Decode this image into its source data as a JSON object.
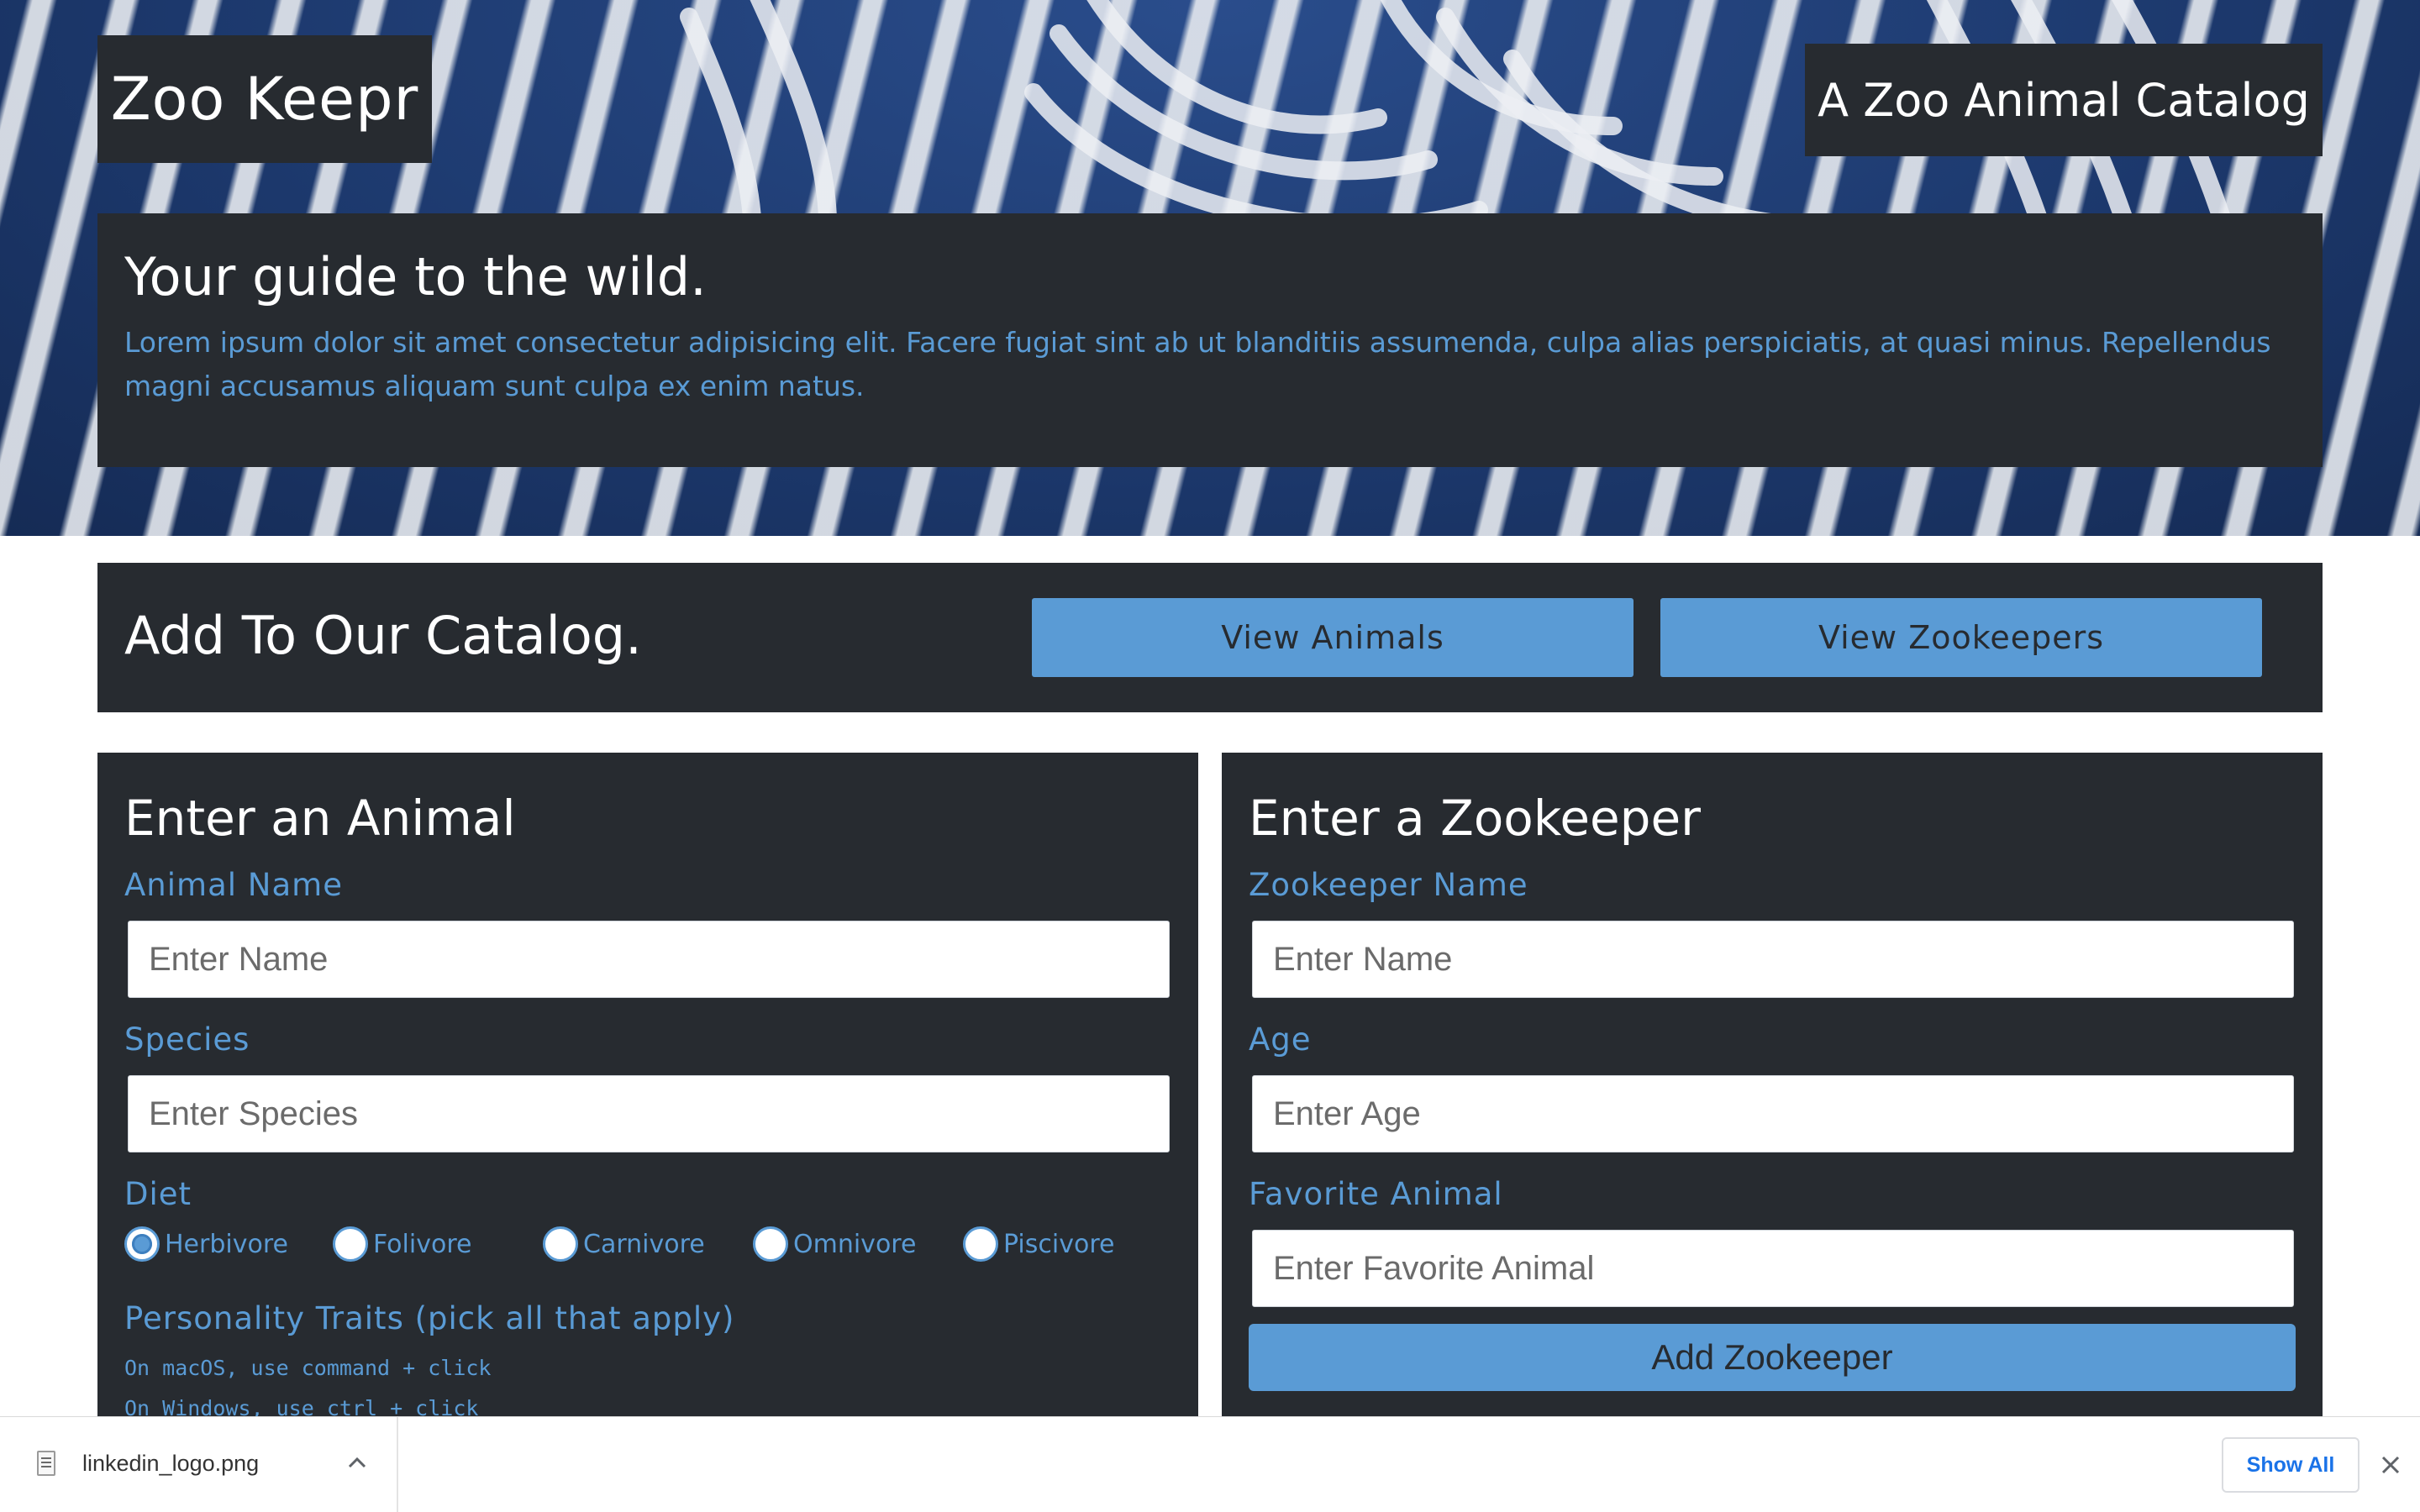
{
  "header": {
    "brand": "Zoo Keepr",
    "tagline": "A Zoo Animal Catalog",
    "intro_title": "Your guide to the wild.",
    "intro_text": "Lorem ipsum dolor sit amet consectetur adipisicing elit. Facere fugiat sint ab ut blanditiis assumenda, culpa alias perspiciatis, at quasi minus. Repellendus magni accusamus aliquam sunt culpa ex enim natus."
  },
  "catalog": {
    "title": "Add To Our Catalog.",
    "view_animals": "View Animals",
    "view_zookeepers": "View Zookeepers"
  },
  "animal_form": {
    "title": "Enter an Animal",
    "name_label": "Animal Name",
    "name_placeholder": "Enter Name",
    "species_label": "Species",
    "species_placeholder": "Enter Species",
    "diet_label": "Diet",
    "diet_options": [
      "Herbivore",
      "Folivore",
      "Carnivore",
      "Omnivore",
      "Piscivore"
    ],
    "diet_selected": "Herbivore",
    "traits_label": "Personality Traits (pick all that apply)",
    "hint_mac": "On macOS, use command + click",
    "hint_windows": "On Windows, use ctrl + click"
  },
  "zookeeper_form": {
    "title": "Enter a Zookeeper",
    "name_label": "Zookeeper Name",
    "name_placeholder": "Enter Name",
    "age_label": "Age",
    "age_placeholder": "Enter Age",
    "favorite_label": "Favorite Animal",
    "favorite_placeholder": "Enter Favorite Animal",
    "submit": "Add Zookeeper"
  },
  "download_bar": {
    "file_name": "linkedin_logo.png",
    "show_all": "Show All"
  },
  "colors": {
    "panel_bg": "#272b30",
    "accent": "#5a9bd5",
    "link_blue": "#1a73e8"
  },
  "icons": {
    "file": "file-icon",
    "chevron": "chevron-up-icon",
    "close": "close-icon"
  }
}
